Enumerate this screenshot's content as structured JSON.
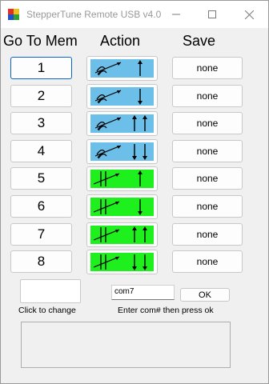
{
  "window": {
    "title": "StepperTune Remote USB v4.0",
    "app_icon": "app-icon",
    "minimize_icon": "minimize-icon",
    "maximize_icon": "maximize-icon",
    "close_icon": "close-icon"
  },
  "headers": {
    "goto": "Go To Mem",
    "action": "Action",
    "save": "Save"
  },
  "rows": [
    {
      "goto_label": "1",
      "save_label": "none",
      "action_color": "#6cbfe8",
      "action_icon": "blue-stepper-up-icon"
    },
    {
      "goto_label": "2",
      "save_label": "none",
      "action_color": "#6cbfe8",
      "action_icon": "blue-stepper-down-icon"
    },
    {
      "goto_label": "3",
      "save_label": "none",
      "action_color": "#6cbfe8",
      "action_icon": "blue-stepper-up-up-icon"
    },
    {
      "goto_label": "4",
      "save_label": "none",
      "action_color": "#6cbfe8",
      "action_icon": "blue-stepper-down-down-icon"
    },
    {
      "goto_label": "5",
      "save_label": "none",
      "action_color": "#1ef01e",
      "action_icon": "green-stepper-up-icon"
    },
    {
      "goto_label": "6",
      "save_label": "none",
      "action_color": "#1ef01e",
      "action_icon": "green-stepper-down-icon"
    },
    {
      "goto_label": "7",
      "save_label": "none",
      "action_color": "#1ef01e",
      "action_icon": "green-stepper-up-up-icon"
    },
    {
      "goto_label": "8",
      "save_label": "none",
      "action_color": "#1ef01e",
      "action_icon": "green-stepper-down-down-icon"
    }
  ],
  "click_to_change_label": "Click to change",
  "com_port": {
    "value": "com7",
    "instruction": "Enter com# then press ok",
    "ok_label": "OK"
  },
  "colors": {
    "accent_border": "#0a64c8",
    "blue_action": "#6cbfe8",
    "green_action": "#1ef01e"
  }
}
